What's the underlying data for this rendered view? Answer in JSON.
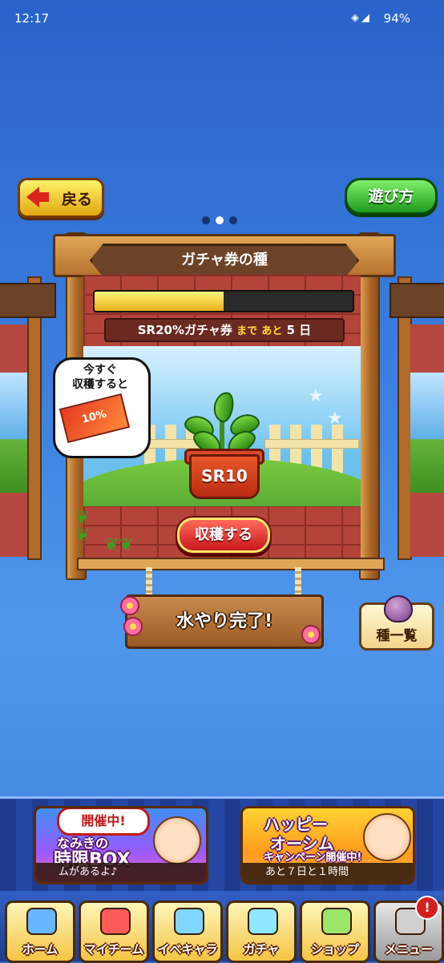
{
  "status_bar": {
    "time": "12:17",
    "battery": "94%"
  },
  "header": {
    "back_label": "戻る",
    "help_label": "遊び方"
  },
  "pager": {
    "pages": 3,
    "active": 1
  },
  "board": {
    "title": "ガチャ券の種",
    "progress": 0.5,
    "reward_name": "SR20%ガチャ券",
    "remaining_prefix": "まで",
    "remaining_word": "あと",
    "remaining_days": "5",
    "days_unit": "日",
    "bubble_line1": "今すぐ",
    "bubble_line2": "収穫すると",
    "ticket_text": "10%",
    "pot_label": "SR10",
    "harvest_label": "収穫する"
  },
  "watering_status": "水やり完了!",
  "seed_list_label": "種一覧",
  "banners": [
    {
      "badge": "開催中!",
      "title_line1": "なみきの",
      "title_line2": "時限BOX",
      "caption": "ムがあるよ♪"
    },
    {
      "title_line1": "ハッピー",
      "title_line2": "オーシム",
      "subtitle": "キャンペーン開催中!",
      "caption": "あと７日と１時間"
    }
  ],
  "nav": [
    {
      "label": "ホーム",
      "icon": "home-icon",
      "color": "#67b7ff"
    },
    {
      "label": "マイチーム",
      "icon": "team-icon",
      "color": "#ff5a5a"
    },
    {
      "label": "イベキャラ",
      "icon": "event-chara-icon",
      "color": "#7fd7ff"
    },
    {
      "label": "ガチャ",
      "icon": "gacha-icon",
      "color": "#8fe8ff"
    },
    {
      "label": "ショップ",
      "icon": "shop-icon",
      "color": "#9be56a"
    },
    {
      "label": "メニュー",
      "icon": "menu-icon",
      "color": "#cfcfcf"
    }
  ],
  "menu_notification": "!"
}
